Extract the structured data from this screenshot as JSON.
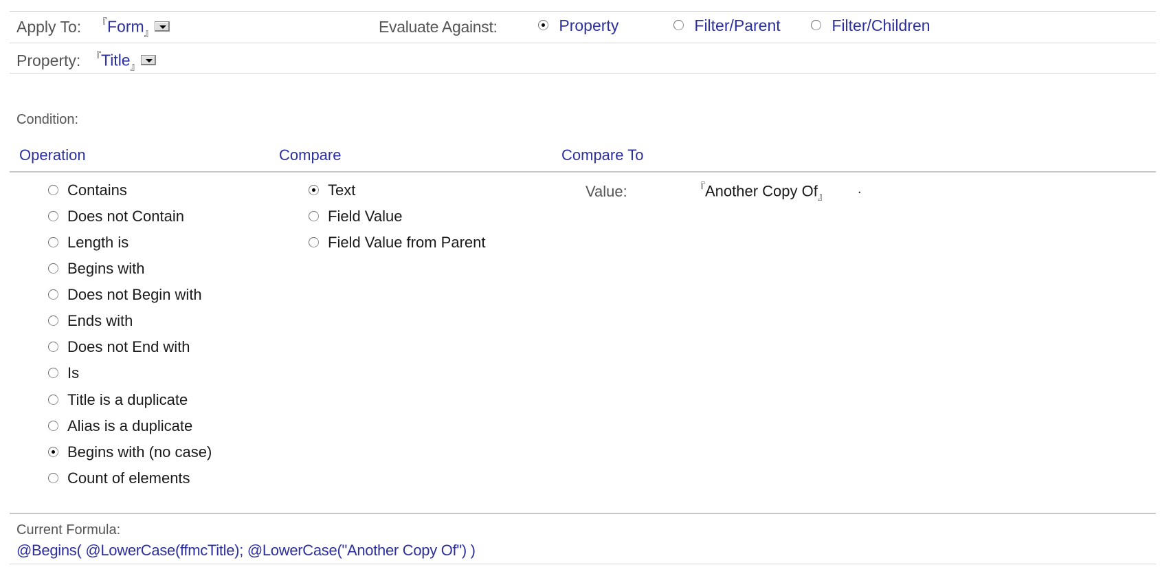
{
  "apply_to": {
    "label": "Apply To:",
    "value": "Form"
  },
  "evaluate": {
    "label": "Evaluate Against:",
    "options": [
      {
        "label": "Property",
        "selected": true
      },
      {
        "label": "Filter/Parent",
        "selected": false
      },
      {
        "label": "Filter/Children",
        "selected": false
      }
    ]
  },
  "property": {
    "label": "Property:",
    "value": "Title"
  },
  "condition_label": "Condition:",
  "columns": {
    "operation": "Operation",
    "compare": "Compare",
    "compare_to": "Compare To"
  },
  "operations": [
    {
      "label": "Contains",
      "selected": false
    },
    {
      "label": "Does not Contain",
      "selected": false
    },
    {
      "label": "Length is",
      "selected": false
    },
    {
      "label": "Begins with",
      "selected": false
    },
    {
      "label": "Does not Begin with",
      "selected": false
    },
    {
      "label": "Ends with",
      "selected": false
    },
    {
      "label": "Does not End with",
      "selected": false
    },
    {
      "label": "Is",
      "selected": false
    },
    {
      "label": "Title is a duplicate",
      "selected": false
    },
    {
      "label": "Alias is a duplicate",
      "selected": false
    },
    {
      "label": "Begins with (no case)",
      "selected": true
    },
    {
      "label": "Count of elements",
      "selected": false
    }
  ],
  "compare": [
    {
      "label": "Text",
      "selected": true
    },
    {
      "label": "Field Value",
      "selected": false
    },
    {
      "label": "Field Value from Parent",
      "selected": false
    }
  ],
  "compare_to": {
    "label": "Value:",
    "value": "Another Copy Of",
    "trailing": "."
  },
  "formula": {
    "label": "Current Formula:",
    "value": "@Begins( @LowerCase(ffmcTitle); @LowerCase(\"Another Copy Of\") )"
  },
  "colors": {
    "link_blue": "#2b2fa0",
    "label_gray": "#555555",
    "rule": "#d6d6d6"
  }
}
